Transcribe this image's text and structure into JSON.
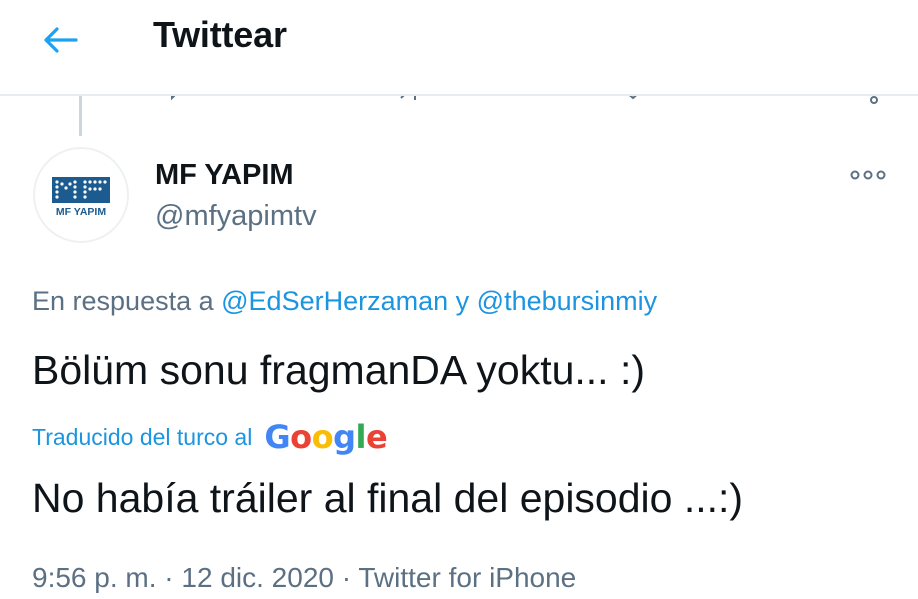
{
  "header": {
    "title": "Twittear",
    "back_icon": "arrow-left-icon",
    "accent_color": "#1da1f2"
  },
  "tweet": {
    "avatar": {
      "logo_text": "MF",
      "logo_subtext": "MF YAPIM",
      "color": "#1c5b8f"
    },
    "display_name": "MF YAPIM",
    "handle": "@mfyapimtv",
    "more_icon": "more-horizontal-icon",
    "reply_context": {
      "prefix": "En respuesta a",
      "mention_1": "@EdSerHerzaman",
      "joiner": "y",
      "mention_2": "@thebursinmiy"
    },
    "text": "Bölüm sonu fragmanDA yoktu... :)",
    "translation": {
      "label": "Traducido del turco al",
      "provider_letters": [
        "G",
        "o",
        "o",
        "g",
        "l",
        "e"
      ],
      "provider_colors": [
        "#4285f4",
        "#ea4335",
        "#fbbc05",
        "#4285f4",
        "#34a853",
        "#ea4335"
      ],
      "text": "No había tráiler al final del episodio ...:)"
    },
    "meta": {
      "time": "9:56 p. m.",
      "separator": "·",
      "date": "12 dic. 2020",
      "source": "Twitter for iPhone"
    }
  },
  "colors": {
    "link": "#1b95e0",
    "secondary_text": "#5b7083",
    "primary_text": "#0f1419",
    "divider": "#e6ecf0"
  }
}
